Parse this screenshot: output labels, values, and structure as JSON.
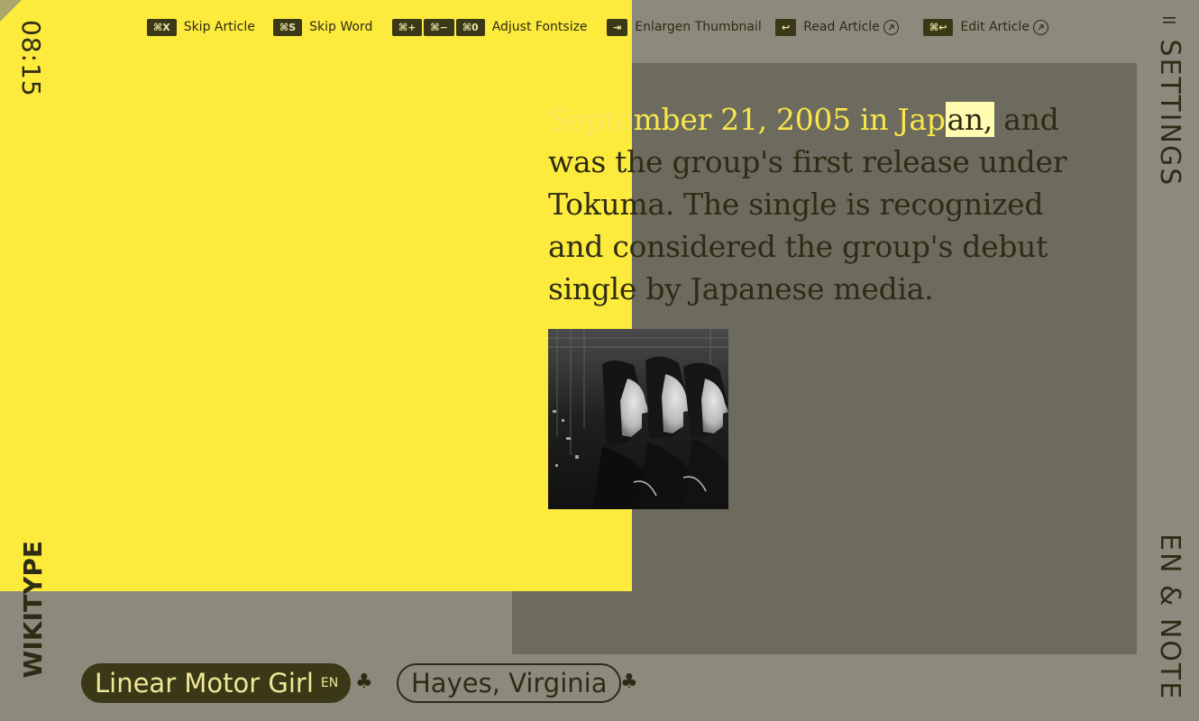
{
  "clock": "08:15",
  "brand": "WIKITYPE",
  "side": {
    "settings_label": "SETTINGS",
    "settings_icon": "pause-bars-icon",
    "lang_note": "EN & NOTE"
  },
  "toolbar": {
    "skip_article": {
      "keys": [
        "⌘X"
      ],
      "label": "Skip Article"
    },
    "skip_word": {
      "keys": [
        "⌘S"
      ],
      "label": "Skip Word"
    },
    "adjust_fontsize": {
      "keys": [
        "⌘+",
        "⌘−",
        "⌘0"
      ],
      "label": "Adjust Fontsize"
    },
    "enlargen_thumbnail": {
      "keys": [
        "⇥"
      ],
      "label": "Enlargen Thumbnail"
    },
    "read_article": {
      "keys": [
        "↩"
      ],
      "label": "Read Article",
      "icon": "external-link-icon"
    },
    "edit_article": {
      "keys": [
        "⌘↩"
      ],
      "label": "Edit Article",
      "icon": "external-link-icon"
    }
  },
  "article": {
    "typed_faint": "Septe",
    "typed": "mber 21, 2005 in Jap",
    "cursor_word": "an,",
    "rest": " and was the group's first release under Tokuma. The single is recognized and considered the group's debut single by Japanese media."
  },
  "thumbnail": {
    "alt": "black and white photo of three women in profile"
  },
  "bottom": {
    "current_article": {
      "title": "Linear Motor Girl",
      "lang": "EN"
    },
    "next_article": {
      "title": "Hayes, Virginia"
    },
    "club_icon": "♣"
  },
  "colors": {
    "background": "#8c8a7c",
    "panel": "#6d6b5e",
    "yellow": "#fcea3d",
    "ink": "#2e2c14",
    "highlight": "#fffbb0"
  }
}
